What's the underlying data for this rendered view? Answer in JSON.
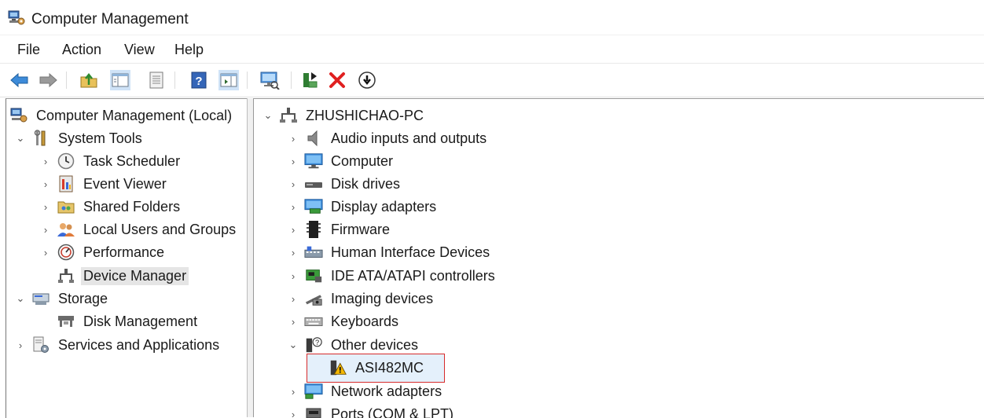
{
  "window": {
    "title": "Computer Management",
    "icon": "computer-management-icon"
  },
  "menu": [
    "File",
    "Action",
    "View",
    "Help"
  ],
  "toolbar": {
    "buttons": [
      {
        "name": "back-arrow-icon"
      },
      {
        "name": "forward-arrow-icon"
      },
      {
        "name": "up-folder-icon"
      },
      {
        "name": "show-hide-console-tree-icon",
        "pressed": true
      },
      {
        "name": "properties-icon"
      },
      {
        "name": "help-icon"
      },
      {
        "name": "show-hide-action-pane-icon",
        "pressed": true
      },
      {
        "name": "scan-hardware-icon"
      },
      {
        "name": "update-driver-icon"
      },
      {
        "name": "uninstall-device-icon"
      },
      {
        "name": "disable-device-icon"
      }
    ]
  },
  "left_tree": [
    {
      "label": "Computer Management (Local)",
      "icon": "computer-management-icon",
      "chevron": "none"
    },
    {
      "label": "System Tools",
      "icon": "tools-icon",
      "chevron": "down"
    },
    {
      "label": "Task Scheduler",
      "icon": "clock-icon",
      "chevron": "right"
    },
    {
      "label": "Event Viewer",
      "icon": "event-viewer-icon",
      "chevron": "right"
    },
    {
      "label": "Shared Folders",
      "icon": "shared-folders-icon",
      "chevron": "right"
    },
    {
      "label": "Local Users and Groups",
      "icon": "users-icon",
      "chevron": "right"
    },
    {
      "label": "Performance",
      "icon": "performance-icon",
      "chevron": "right"
    },
    {
      "label": "Device Manager",
      "icon": "device-manager-icon",
      "chevron": "none",
      "selected": true
    },
    {
      "label": "Storage",
      "icon": "storage-icon",
      "chevron": "down"
    },
    {
      "label": "Disk Management",
      "icon": "disk-management-icon",
      "chevron": "none"
    },
    {
      "label": "Services and Applications",
      "icon": "services-icon",
      "chevron": "right"
    }
  ],
  "right_tree": [
    {
      "label": "ZHUSHICHAO-PC",
      "icon": "network-computer-icon",
      "chevron": "down"
    },
    {
      "label": "Audio inputs and outputs",
      "icon": "speaker-icon",
      "chevron": "right"
    },
    {
      "label": "Computer",
      "icon": "monitor-icon",
      "chevron": "right"
    },
    {
      "label": "Disk drives",
      "icon": "disk-drive-icon",
      "chevron": "right"
    },
    {
      "label": "Display adapters",
      "icon": "display-adapter-icon",
      "chevron": "right"
    },
    {
      "label": "Firmware",
      "icon": "firmware-chip-icon",
      "chevron": "right"
    },
    {
      "label": "Human Interface Devices",
      "icon": "hid-icon",
      "chevron": "right"
    },
    {
      "label": "IDE ATA/ATAPI controllers",
      "icon": "ide-controller-icon",
      "chevron": "right"
    },
    {
      "label": "Imaging devices",
      "icon": "camera-icon",
      "chevron": "right"
    },
    {
      "label": "Keyboards",
      "icon": "keyboard-icon",
      "chevron": "right"
    },
    {
      "label": "Other devices",
      "icon": "unknown-device-icon",
      "chevron": "down"
    },
    {
      "label": "ASI482MC",
      "icon": "warning-device-icon",
      "chevron": "none",
      "highlighted": true
    },
    {
      "label": "Network adapters",
      "icon": "network-adapter-icon",
      "chevron": "right"
    },
    {
      "label": "Ports (COM & LPT)",
      "icon": "port-icon",
      "chevron": "right"
    }
  ],
  "colors": {
    "highlight_border": "#d62b2b",
    "selection_bg": "#e5e5e5",
    "highlight_bg": "#e4f0fb"
  }
}
